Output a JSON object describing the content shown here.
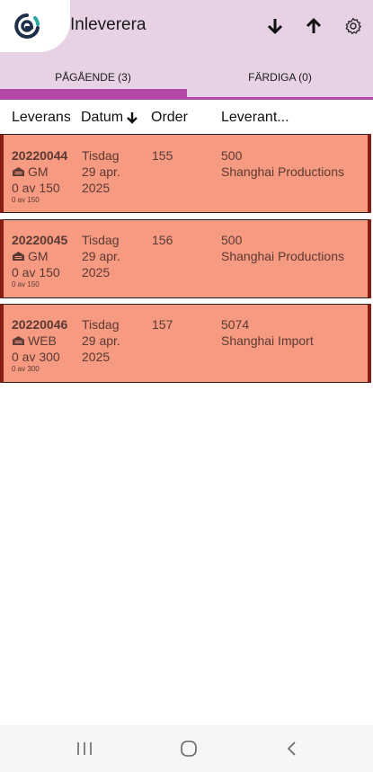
{
  "app": {
    "title": "Inleverera"
  },
  "icons": {
    "logo": "logo-icon",
    "download": "arrow-down-icon",
    "upload": "arrow-up-icon",
    "settings": "gear-icon"
  },
  "tabs": [
    {
      "label": "PÅGÅENDE (3)"
    },
    {
      "label": "FÄRDIGA (0)"
    }
  ],
  "columns": {
    "delivery": "Leverans",
    "date": "Datum",
    "order": "Order",
    "supplier": "Leverant..."
  },
  "rows": [
    {
      "id": "20220044",
      "warehouse": "GM",
      "progress": "0 av 150",
      "progress_small": "0 av 150",
      "day": "Tisdag",
      "date": "29 apr.",
      "year": "2025",
      "order": "155",
      "supplier_no": "500",
      "supplier_name": "Shanghai Productions"
    },
    {
      "id": "20220045",
      "warehouse": "GM",
      "progress": "0 av 150",
      "progress_small": "0 av 150",
      "day": "Tisdag",
      "date": "29 apr.",
      "year": "2025",
      "order": "156",
      "supplier_no": "500",
      "supplier_name": "Shanghai Productions"
    },
    {
      "id": "20220046",
      "warehouse": "WEB",
      "progress": "0 av 300",
      "progress_small": "0 av 300",
      "day": "Tisdag",
      "date": "29 apr.",
      "year": "2025",
      "order": "157",
      "supplier_no": "5074",
      "supplier_name": "Shanghai Import"
    }
  ],
  "colors": {
    "header_bg": "#e7d1e4",
    "accent": "#b548a6",
    "row_bg": "#f79a82",
    "row_border": "#8b1e14"
  }
}
